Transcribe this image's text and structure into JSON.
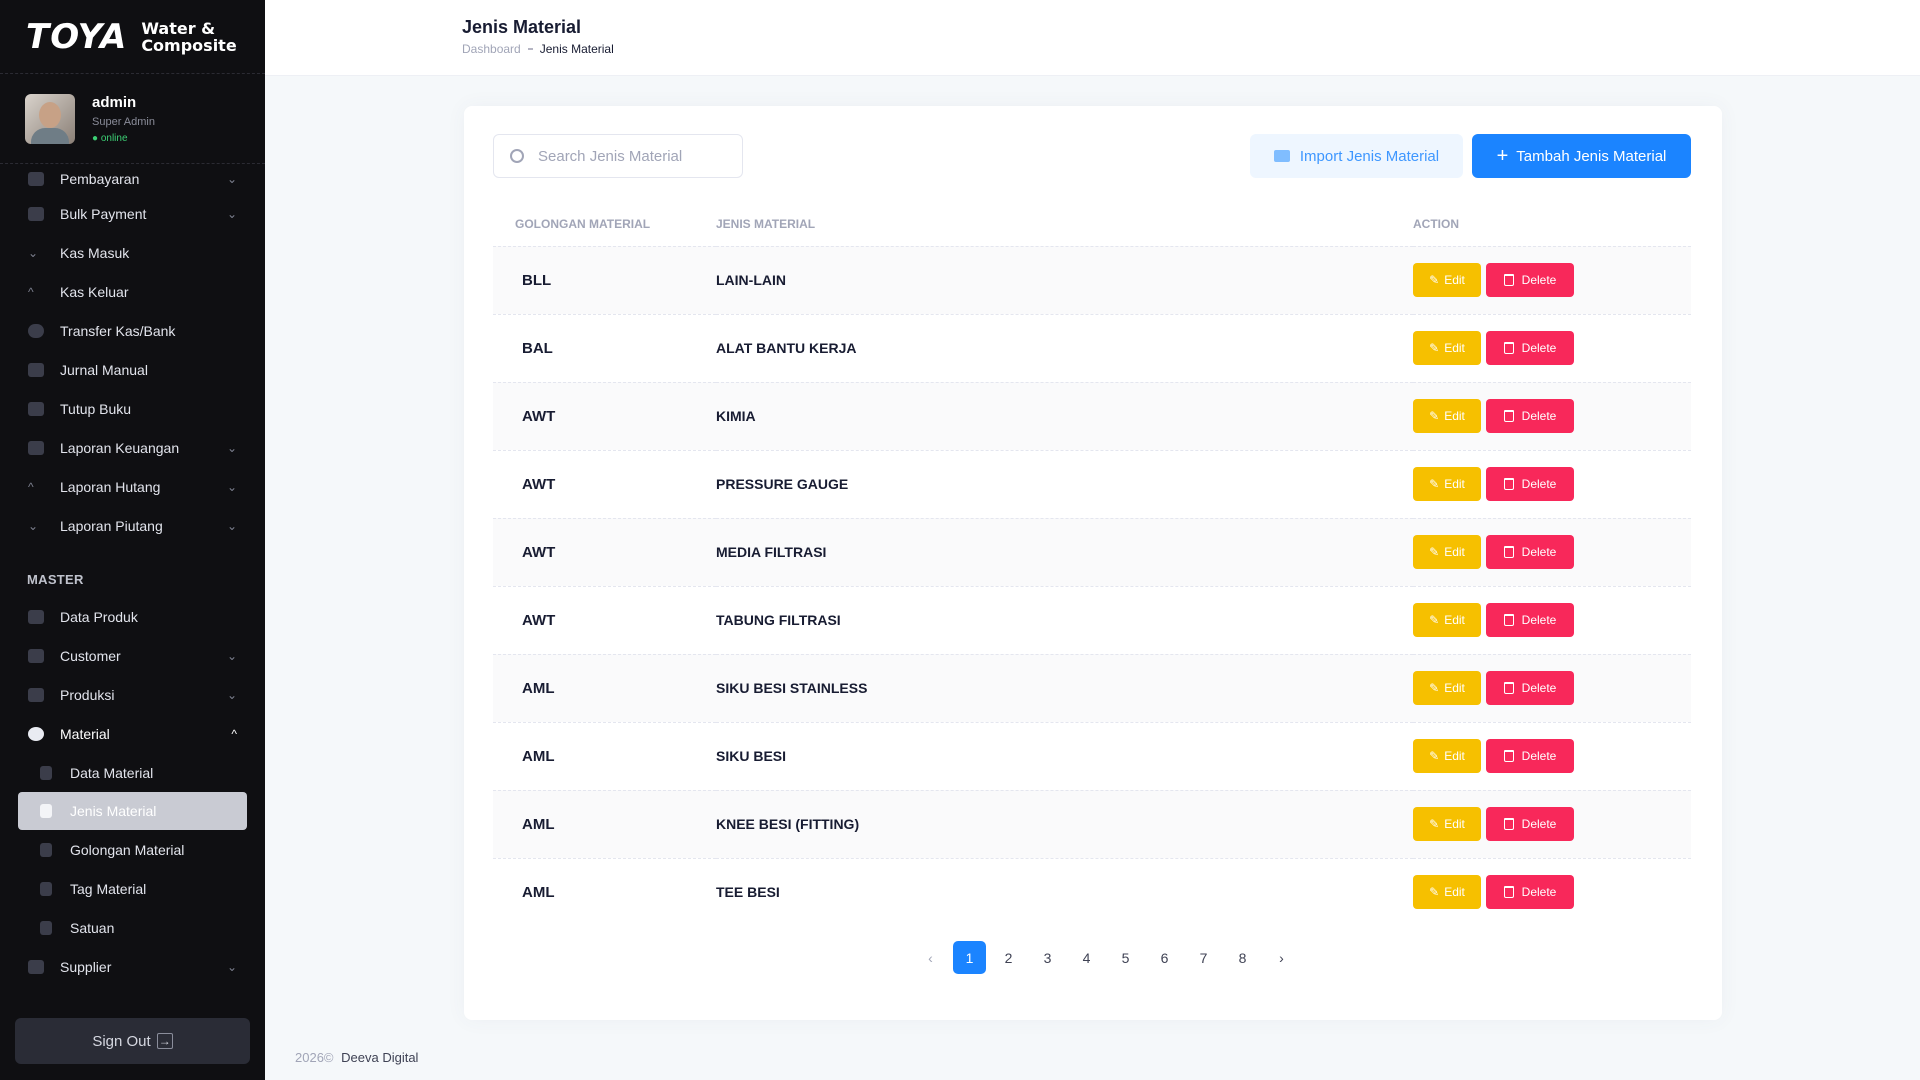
{
  "brand": {
    "logo": "TOYA",
    "sub_line1": "Water &",
    "sub_line2": "Composite"
  },
  "user": {
    "name": "admin",
    "role": "Super Admin",
    "status": "● online"
  },
  "sidebar": {
    "top_items": [
      {
        "label": "Pembayaran",
        "icon": "payment-icon",
        "chevron": true
      },
      {
        "label": "Bulk Payment",
        "icon": "wallet-icon",
        "chevron": true
      },
      {
        "label": "Kas Masuk",
        "icon": "arrow-down-icon",
        "chevron": false
      },
      {
        "label": "Kas Keluar",
        "icon": "arrow-up-icon",
        "chevron": false
      },
      {
        "label": "Transfer Kas/Bank",
        "icon": "toggle-icon",
        "chevron": false
      },
      {
        "label": "Jurnal Manual",
        "icon": "journal-icon",
        "chevron": false
      },
      {
        "label": "Tutup Buku",
        "icon": "book-icon",
        "chevron": false
      },
      {
        "label": "Laporan Keuangan",
        "icon": "chart-icon",
        "chevron": true
      },
      {
        "label": "Laporan Hutang",
        "icon": "arrow-up-icon",
        "chevron": true
      },
      {
        "label": "Laporan Piutang",
        "icon": "arrow-down-icon",
        "chevron": true
      }
    ],
    "section_master": "MASTER",
    "master_items": [
      {
        "label": "Data Produk"
      },
      {
        "label": "Customer"
      },
      {
        "label": "Produksi"
      },
      {
        "label": "Material"
      }
    ],
    "material_sub": [
      {
        "label": "Data Material"
      },
      {
        "label": "Jenis Material"
      },
      {
        "label": "Golongan Material"
      },
      {
        "label": "Tag Material"
      },
      {
        "label": "Satuan"
      }
    ],
    "supplier": "Supplier",
    "signout": "Sign Out",
    "signout_icon": "→"
  },
  "header": {
    "title": "Jenis Material",
    "bc_home": "Dashboard",
    "bc_current": "Jenis Material"
  },
  "toolbar": {
    "search_placeholder": "Search Jenis Material",
    "import_label": "Import Jenis Material",
    "add_label": "Tambah Jenis Material",
    "add_icon": "+"
  },
  "table": {
    "columns": [
      "GOLONGAN MATERIAL",
      "JENIS MATERIAL",
      "ACTION"
    ],
    "rows": [
      {
        "golongan": "BLL",
        "jenis": "LAIN-LAIN"
      },
      {
        "golongan": "BAL",
        "jenis": "ALAT BANTU KERJA"
      },
      {
        "golongan": "AWT",
        "jenis": "KIMIA"
      },
      {
        "golongan": "AWT",
        "jenis": "PRESSURE GAUGE"
      },
      {
        "golongan": "AWT",
        "jenis": "MEDIA FILTRASI"
      },
      {
        "golongan": "AWT",
        "jenis": "TABUNG FILTRASI"
      },
      {
        "golongan": "AML",
        "jenis": "SIKU BESI STAINLESS"
      },
      {
        "golongan": "AML",
        "jenis": "SIKU BESI"
      },
      {
        "golongan": "AML",
        "jenis": "KNEE BESI (FITTING)"
      },
      {
        "golongan": "AML",
        "jenis": "TEE BESI"
      }
    ],
    "edit_label": "Edit",
    "edit_icon": "✎",
    "delete_label": "Delete"
  },
  "pagination": {
    "prev": "‹",
    "next": "›",
    "pages": [
      "1",
      "2",
      "3",
      "4",
      "5",
      "6",
      "7",
      "8"
    ],
    "current": "1"
  },
  "footer": {
    "year": "2026©",
    "company": "Deeva Digital"
  },
  "colors": {
    "primary": "#1b84ff",
    "warning": "#f6c000",
    "danger": "#f8285a",
    "sidebar_bg": "#0f0f12"
  }
}
